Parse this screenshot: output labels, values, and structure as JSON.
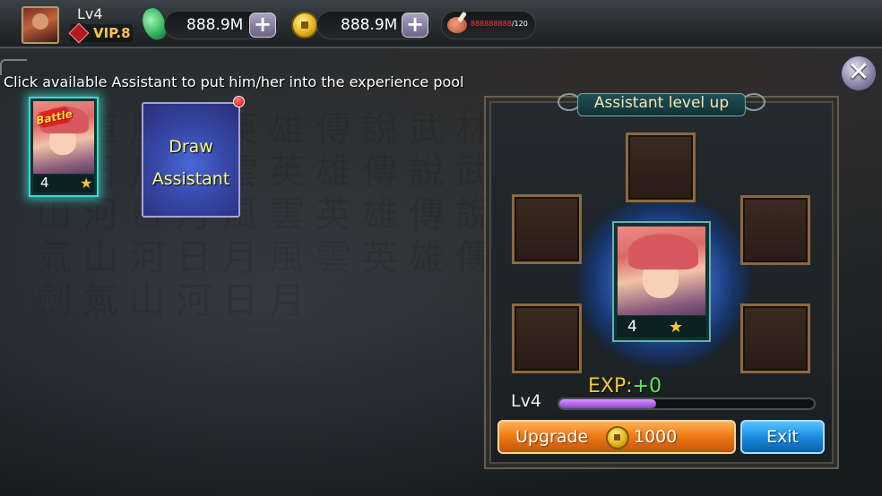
{
  "player": {
    "level": "Lv4",
    "vip": "VIP.8"
  },
  "resources": {
    "jade": {
      "value": "888.9M",
      "icon": "jade-icon"
    },
    "gold": {
      "value": "888.9M",
      "icon": "gold-coin-icon"
    },
    "stamina": {
      "value": "888888888",
      "max": "/120",
      "icon": "meat-icon"
    }
  },
  "instruction": "Click available Assistant to put him/her into the experience pool",
  "assistants": [
    {
      "level": "4",
      "badge": "Battle",
      "stars": "★"
    }
  ],
  "draw_button": {
    "line1": "Draw",
    "line2": "Assistant"
  },
  "panel": {
    "title": "Assistant level up",
    "target": {
      "level": "4",
      "stars": "★"
    },
    "exp_label": "EXP:",
    "exp_gain": "+0",
    "level": "Lv4",
    "exp_progress": 0.38,
    "upgrade_label": "Upgrade",
    "upgrade_cost": "1000",
    "exit_label": "Exit"
  },
  "colors": {
    "accent_orange": "#f07c16",
    "accent_blue": "#1b8be0",
    "exp_purple": "#8d3ed1",
    "exp_text": "#f6c838",
    "exp_gain": "#52f053"
  }
}
